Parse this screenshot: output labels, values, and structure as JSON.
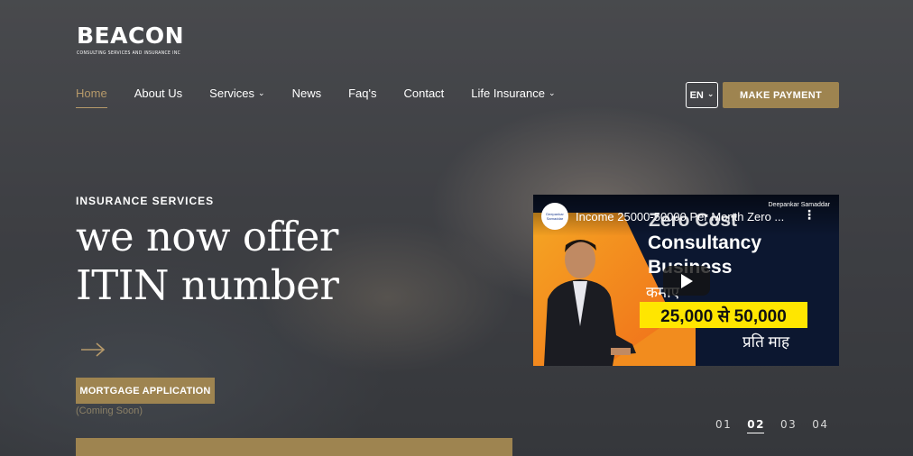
{
  "brand": {
    "name": "BEACON",
    "tagline": "CONSULTING SERVICES AND INSURANCE INC"
  },
  "nav": {
    "items": [
      {
        "label": "Home",
        "active": true
      },
      {
        "label": "About Us"
      },
      {
        "label": "Services",
        "dropdown": true
      },
      {
        "label": "News"
      },
      {
        "label": "Faq's"
      },
      {
        "label": "Contact"
      },
      {
        "label": "Life Insurance",
        "dropdown": true
      }
    ],
    "language": "EN",
    "payment_label": "MAKE PAYMENT"
  },
  "hero": {
    "eyebrow": "INSURANCE SERVICES",
    "headline_line1": "we now offer",
    "headline_line2": "ITIN number",
    "mortgage_button": "MORTGAGE APPLICATION",
    "coming_soon": "(Coming Soon)"
  },
  "video": {
    "title": "Income 25000-50000 Per Month Zero ...",
    "channel_logo_text": "Deepankar Samaddar",
    "brand_mark": "Deepankar Samaddar",
    "line1": "Zero Cost",
    "line2": "Consultancy",
    "line3": "Business",
    "hindi1": "कमाए",
    "amount": "25,000 से 50,000",
    "hindi2": "प्रति माह"
  },
  "pager": {
    "items": [
      "01",
      "02",
      "03",
      "04"
    ],
    "active_index": 1
  },
  "colors": {
    "accent": "#9e8450",
    "accent_text": "#b6996a"
  }
}
